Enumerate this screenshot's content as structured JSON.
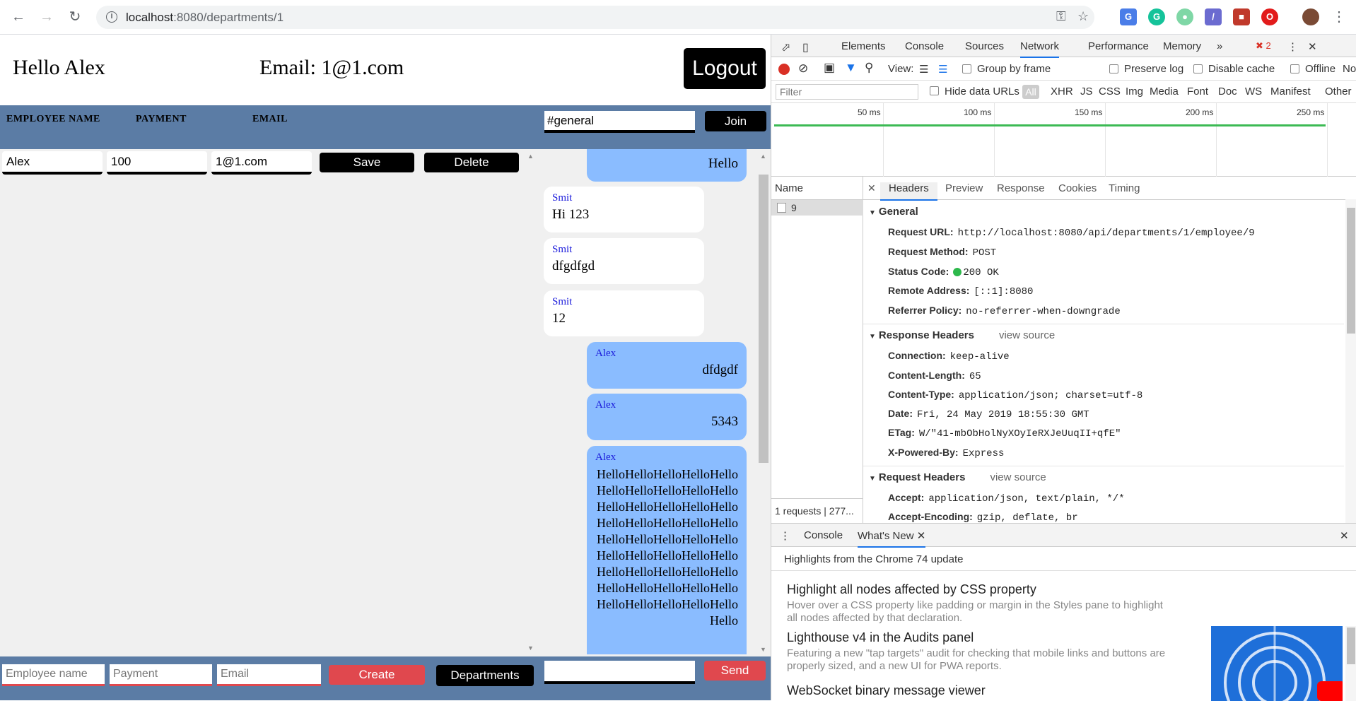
{
  "browser": {
    "url_host": "localhost",
    "url_path": ":8080/departments/1"
  },
  "app": {
    "greeting": "Hello Alex",
    "email_label": "Email: 1@1.com",
    "logout_label": "Logout",
    "columns": [
      "EMPLOYEE NAME",
      "PAYMENT",
      "EMAIL"
    ],
    "channel_value": "#general",
    "join_label": "Join",
    "employee": {
      "name": "Alex",
      "payment": "100",
      "email": "1@1.com"
    },
    "save_label": "Save",
    "delete_label": "Delete",
    "messages": [
      {
        "author": "",
        "text": "Hello",
        "mine": true
      },
      {
        "author": "Smit",
        "text": "Hi 123",
        "mine": false
      },
      {
        "author": "Smit",
        "text": "dfgdfgd",
        "mine": false
      },
      {
        "author": "Smit",
        "text": "12",
        "mine": false
      },
      {
        "author": "Alex",
        "text": "dfdgdf",
        "mine": true
      },
      {
        "author": "Alex",
        "text": "5343",
        "mine": true
      },
      {
        "author": "Alex",
        "text": "HelloHelloHelloHelloHelloHelloHelloHelloHelloHelloHelloHelloHelloHelloHelloHelloHelloHelloHelloHelloHelloHelloHelloHelloHelloHelloHelloHelloHelloHelloHelloHelloHelloHelloHelloHelloHelloHelloHelloHelloHelloHelloHelloHelloHelloHello",
        "mine": true
      }
    ],
    "footer": {
      "name_placeholder": "Employee name",
      "payment_placeholder": "Payment",
      "email_placeholder": "Email",
      "create_label": "Create",
      "departments_label": "Departments",
      "send_label": "Send"
    }
  },
  "devtools": {
    "tabs": [
      "Elements",
      "Console",
      "Sources",
      "Network",
      "Performance",
      "Memory"
    ],
    "active_tab": "Network",
    "error_count": "2",
    "toolbar": {
      "view_label": "View:",
      "group_by_frame": "Group by frame",
      "preserve_log": "Preserve log",
      "disable_cache": "Disable cache",
      "offline": "Offline",
      "throttle": "No"
    },
    "filter_placeholder": "Filter",
    "hide_data_urls": "Hide data URLs",
    "type_filters": [
      "All",
      "XHR",
      "JS",
      "CSS",
      "Img",
      "Media",
      "Font",
      "Doc",
      "WS",
      "Manifest",
      "Other"
    ],
    "timeline_ticks": [
      "50 ms",
      "100 ms",
      "150 ms",
      "200 ms",
      "250 ms"
    ],
    "name_header": "Name",
    "request_name": "9",
    "requests_summary": "1 requests | 277...",
    "detail_tabs": [
      "Headers",
      "Preview",
      "Response",
      "Cookies",
      "Timing"
    ],
    "general": {
      "title": "General",
      "request_url": "http://localhost:8080/api/departments/1/employee/9",
      "request_method": "POST",
      "status_code": "200 OK",
      "remote_address": "[::1]:8080",
      "referrer_policy": "no-referrer-when-downgrade"
    },
    "response_headers": {
      "title": "Response Headers",
      "view_source": "view source",
      "connection": "keep-alive",
      "content_length": "65",
      "content_type": "application/json; charset=utf-8",
      "date": "Fri, 24 May 2019 18:55:30 GMT",
      "etag": "W/\"41-mbObHolNyXOyIeRXJeUuqII+qfE\"",
      "x_powered_by": "Express"
    },
    "request_headers": {
      "title": "Request Headers",
      "view_source": "view source",
      "accept": "application/json, text/plain, */*",
      "accept_encoding": "gzip, deflate, br"
    },
    "drawer": {
      "tabs": [
        "Console",
        "What's New"
      ],
      "highlights": "Highlights from the Chrome 74 update",
      "items": [
        {
          "title": "Highlight all nodes affected by CSS property",
          "desc": "Hover over a CSS property like padding or margin in the Styles pane to highlight all nodes affected by that declaration."
        },
        {
          "title": "Lighthouse v4 in the Audits panel",
          "desc": "Featuring a new \"tap targets\" audit for checking that mobile links and buttons are properly sized, and a new UI for PWA reports."
        },
        {
          "title": "WebSocket binary message viewer",
          "desc": ""
        }
      ]
    }
  }
}
